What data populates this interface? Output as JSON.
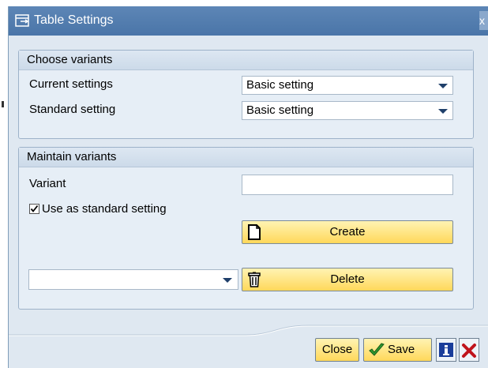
{
  "dialog": {
    "title": "Table Settings",
    "close_glyph": "x"
  },
  "choose_variants": {
    "header": "Choose variants",
    "current_label": "Current settings",
    "current_value": "Basic setting",
    "standard_label": "Standard setting",
    "standard_value": "Basic setting"
  },
  "maintain_variants": {
    "header": "Maintain variants",
    "variant_label": "Variant",
    "variant_value": "",
    "use_standard_label": "Use as standard setting",
    "use_standard_checked": true,
    "create_label": "Create",
    "delete_label": "Delete",
    "delete_select_value": ""
  },
  "footer": {
    "close_label": "Close",
    "save_label": "Save"
  },
  "icons": {
    "title": "table-settings-icon",
    "create": "new-document-icon",
    "delete": "trash-icon",
    "save": "checkmark-icon",
    "info": "info-icon",
    "cancel": "cancel-icon"
  },
  "colors": {
    "title_bar": "#4a75a8",
    "button_yellow": "#ffd85a",
    "dialog_bg": "#dfe8f1"
  }
}
